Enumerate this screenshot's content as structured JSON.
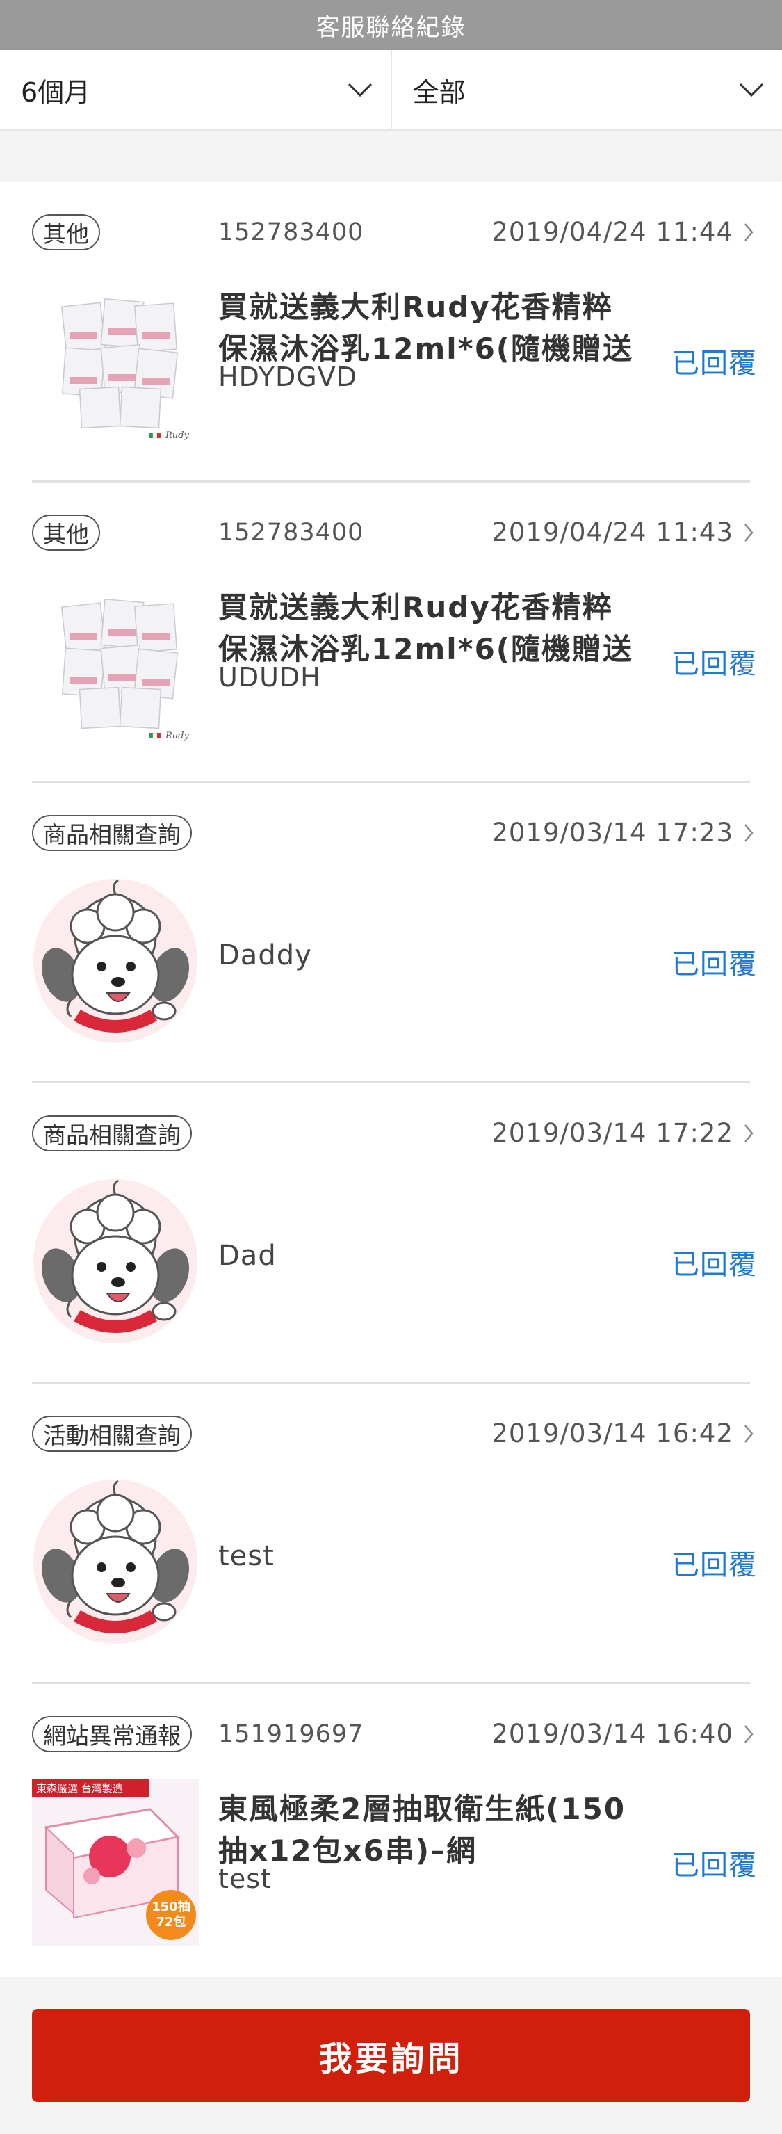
{
  "header": {
    "title": "客服聯絡紀錄"
  },
  "filters": {
    "period": "6個月",
    "type": "全部"
  },
  "status_color": "#1f7ad6",
  "items": [
    {
      "category": "其他",
      "ticket": "152783400",
      "date": "2019/04/24 11:44",
      "title": "買就送義大利Rudy花香精粹保濕沐浴乳12ml*6(隨機贈送",
      "message": "HDYDGVD",
      "status": "已回覆",
      "thumb_brand": "Rudy"
    },
    {
      "category": "其他",
      "ticket": "152783400",
      "date": "2019/04/24 11:43",
      "title": "買就送義大利Rudy花香精粹保濕沐浴乳12ml*6(隨機贈送",
      "message": "UDUDH",
      "status": "已回覆",
      "thumb_brand": "Rudy"
    },
    {
      "category": "商品相關查詢",
      "ticket": "",
      "date": "2019/03/14 17:23",
      "title": "",
      "message": "Daddy",
      "status": "已回覆"
    },
    {
      "category": "商品相關查詢",
      "ticket": "",
      "date": "2019/03/14 17:22",
      "title": "",
      "message": "Dad",
      "status": "已回覆"
    },
    {
      "category": "活動相關查詢",
      "ticket": "",
      "date": "2019/03/14 16:42",
      "title": "",
      "message": "test",
      "status": "已回覆"
    },
    {
      "category": "網站異常通報",
      "ticket": "151919697",
      "date": "2019/03/14 16:40",
      "title": "東風極柔2層抽取衛生紙(150抽x12包x6串)–網",
      "message": "test",
      "status": "已回覆",
      "thumb_banner": "東森嚴選 台灣製造",
      "thumb_badge1": "150抽",
      "thumb_badge2": "72包"
    }
  ],
  "footer": {
    "ask_button": "我要詢問"
  }
}
